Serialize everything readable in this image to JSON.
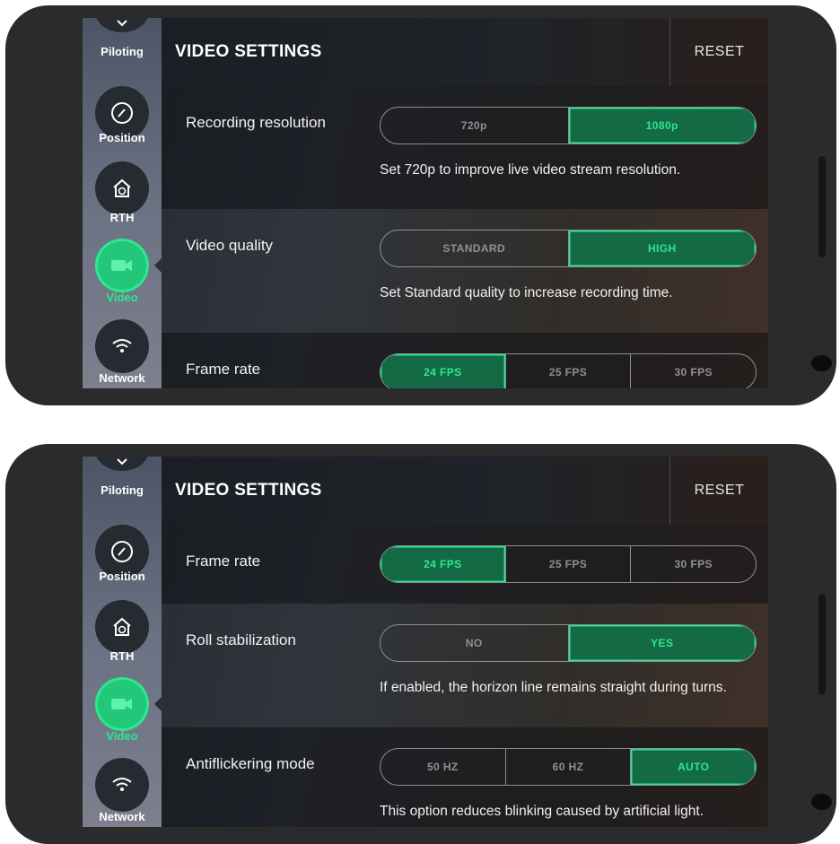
{
  "screens": [
    {
      "header": {
        "title": "VIDEO SETTINGS",
        "reset_label": "RESET"
      },
      "sidebar": {
        "items": [
          {
            "label": "Piloting",
            "icon": "chevron-down-icon"
          },
          {
            "label": "Position",
            "icon": "gauge-icon"
          },
          {
            "label": "RTH",
            "icon": "home-icon"
          },
          {
            "label": "Video",
            "icon": "video-camera-icon",
            "active": true
          },
          {
            "label": "Network",
            "icon": "wifi-icon"
          }
        ]
      },
      "rows": [
        {
          "label": "Recording resolution",
          "options": [
            "720p",
            "1080p"
          ],
          "selected": "1080p",
          "description": "Set 720p to improve live video stream resolution."
        },
        {
          "label": "Video quality",
          "options": [
            "STANDARD",
            "HIGH"
          ],
          "selected": "HIGH",
          "description": "Set Standard quality to increase recording time."
        },
        {
          "label": "Frame rate",
          "options": [
            "24 FPS",
            "25 FPS",
            "30 FPS"
          ],
          "selected": "24 FPS",
          "description": ""
        }
      ]
    },
    {
      "header": {
        "title": "VIDEO SETTINGS",
        "reset_label": "RESET"
      },
      "sidebar": {
        "items": [
          {
            "label": "Piloting",
            "icon": "chevron-down-icon"
          },
          {
            "label": "Position",
            "icon": "gauge-icon"
          },
          {
            "label": "RTH",
            "icon": "home-icon"
          },
          {
            "label": "Video",
            "icon": "video-camera-icon",
            "active": true
          },
          {
            "label": "Network",
            "icon": "wifi-icon"
          }
        ]
      },
      "rows": [
        {
          "label": "Frame rate",
          "options": [
            "24 FPS",
            "25 FPS",
            "30 FPS"
          ],
          "selected": "24 FPS",
          "description": ""
        },
        {
          "label": "Roll stabilization",
          "options": [
            "NO",
            "YES"
          ],
          "selected": "YES",
          "description": "If enabled, the horizon line remains straight during turns."
        },
        {
          "label": "Antiflickering mode",
          "options": [
            "50 HZ",
            "60 HZ",
            "AUTO"
          ],
          "selected": "AUTO",
          "description": "This option reduces blinking caused by artificial light."
        }
      ]
    }
  ],
  "colors": {
    "accent_green": "#2ee78f",
    "selected_fill": "#136a44",
    "phone_body": "#2b2b2b"
  }
}
